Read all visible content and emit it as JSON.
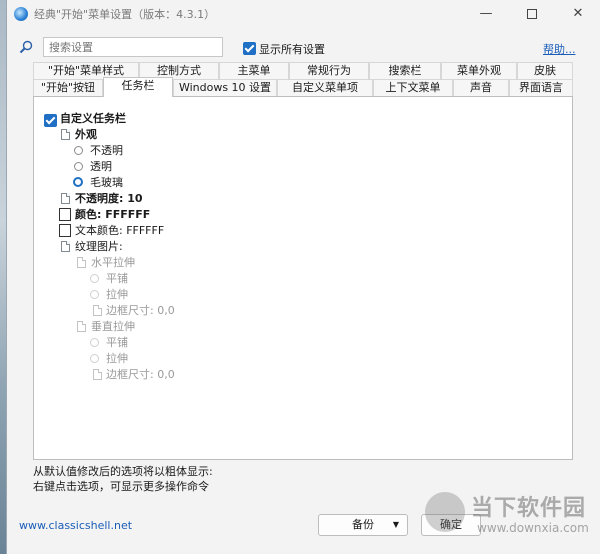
{
  "window": {
    "title": "经典\"开始\"菜单设置（版本：4.3.1）",
    "minimize": "—",
    "close": "✕"
  },
  "search": {
    "placeholder": "搜索设置",
    "show_all_label": "显示所有设置",
    "show_all_checked": true,
    "help_link": "帮助..."
  },
  "tabs_row1": [
    {
      "label": "\"开始\"菜单样式"
    },
    {
      "label": "控制方式"
    },
    {
      "label": "主菜单"
    },
    {
      "label": "常规行为"
    },
    {
      "label": "搜索栏"
    },
    {
      "label": "菜单外观"
    },
    {
      "label": "皮肤"
    }
  ],
  "tabs_row2": [
    {
      "label": "\"开始\"按钮"
    },
    {
      "label": "任务栏",
      "active": true
    },
    {
      "label": "Windows 10 设置"
    },
    {
      "label": "自定义菜单项"
    },
    {
      "label": "上下文菜单"
    },
    {
      "label": "声音"
    },
    {
      "label": "界面语言"
    }
  ],
  "tree": {
    "customize_taskbar": "自定义任务栏",
    "appearance": "外观",
    "opaque": "不透明",
    "transparent": "透明",
    "glass": "毛玻璃",
    "opacity": "不透明度: 10",
    "color": "颜色: FFFFFF",
    "text_color": "文本颜色: FFFFFF",
    "texture": "纹理图片:",
    "h_stretch": "水平拉伸",
    "h_tile": "平铺",
    "h_stretch_opt": "拉伸",
    "h_border": "边框尺寸: 0,0",
    "v_stretch": "垂直拉伸",
    "v_tile": "平铺",
    "v_stretch_opt": "拉伸",
    "v_border": "边框尺寸: 0,0"
  },
  "notes": {
    "line1": "从默认值修改后的选项将以粗体显示:",
    "line2": "右键点击选项，可显示更多操作命令"
  },
  "footer": {
    "link": "www.classicshell.net",
    "backup_label": "备份",
    "ok_label": "确定"
  },
  "watermark": {
    "text": "当下软件园",
    "url": "www.downxia.com"
  }
}
